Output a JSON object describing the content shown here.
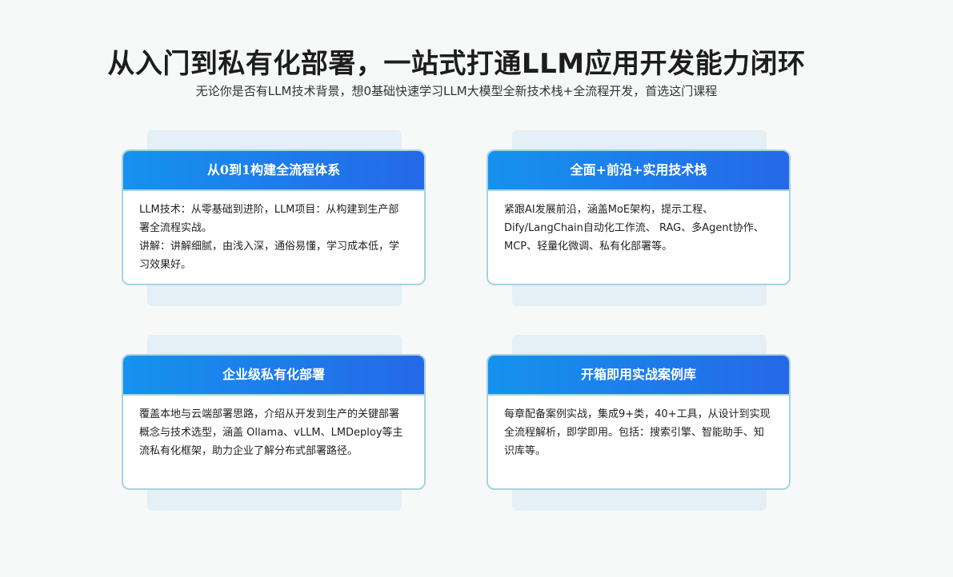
{
  "header": {
    "title": "从入门到私有化部署，一站式打通LLM应用开发能力闭环",
    "subtitle": "无论你是否有LLM技术背景，想0基础快速学习LLM大模型全新技术栈+全流程开发，首选这门课程"
  },
  "cards": [
    {
      "title": "从0到1构建全流程体系",
      "paragraphs": [
        "LLM技术：从零基础到进阶，LLM项目：从构建到生产部署全流程实战。",
        "讲解：讲解细腻，由浅入深，通俗易懂，学习成本低，学习效果好。"
      ]
    },
    {
      "title": "全面+前沿+实用技术栈",
      "paragraphs": [
        "紧跟AI发展前沿，涵盖MoE架构，提示工程、Dify/LangChain自动化工作流、 RAG、多Agent协作、MCP、轻量化微调、私有化部署等。"
      ]
    },
    {
      "title": "企业级私有化部署",
      "paragraphs": [
        "覆盖本地与云端部署思路，介绍从开发到生产的关键部署概念与技术选型，涵盖 Ollama、vLLM、LMDeploy等主流私有化框架，助力企业了解分布式部署路径。"
      ]
    },
    {
      "title": "开箱即用实战案例库",
      "paragraphs": [
        "每章配备案例实战，集成9+类，40+工具，从设计到实现全流程解析，即学即用。包括：搜索引擎、智能助手、知识库等。"
      ]
    }
  ]
}
